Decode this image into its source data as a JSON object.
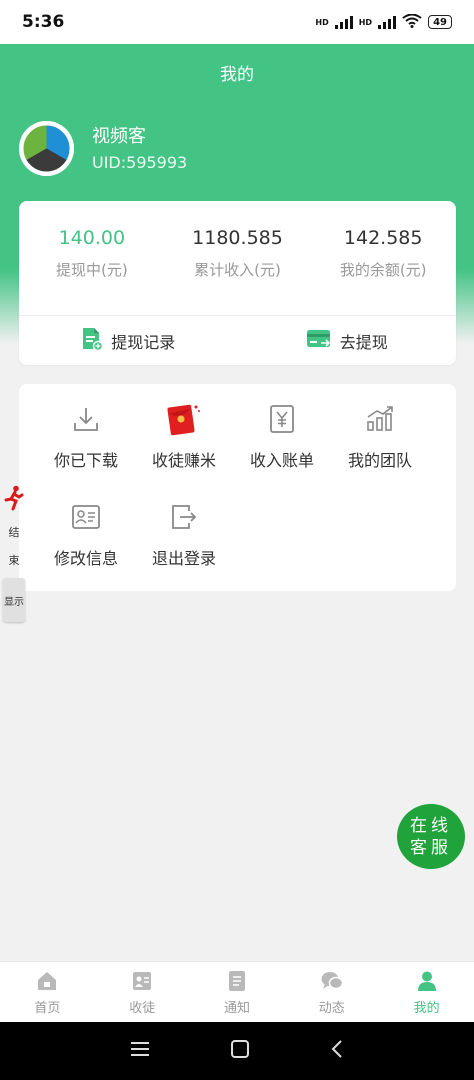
{
  "status": {
    "time": "5:36",
    "hd1": "HD",
    "hd2": "HD",
    "battery": "49"
  },
  "header": {
    "title": "我的"
  },
  "profile": {
    "name": "视频客",
    "uid": "UID:595993"
  },
  "stats": [
    {
      "value": "140.00",
      "label": "提现中(元)"
    },
    {
      "value": "1180.585",
      "label": "累计收入(元)"
    },
    {
      "value": "142.585",
      "label": "我的余额(元)"
    }
  ],
  "actions": {
    "records": "提现记录",
    "withdraw": "去提现"
  },
  "menu": [
    {
      "label": "你已下载",
      "icon": "download-icon"
    },
    {
      "label": "收徒赚米",
      "icon": "red-envelope-icon"
    },
    {
      "label": "收入账单",
      "icon": "bill-icon"
    },
    {
      "label": "我的团队",
      "icon": "team-chart-icon"
    },
    {
      "label": "修改信息",
      "icon": "id-card-icon"
    },
    {
      "label": "退出登录",
      "icon": "logout-icon"
    }
  ],
  "float_tool": {
    "label1": "结",
    "label2": "束",
    "show": "显示"
  },
  "customer_service": {
    "line1": "在线",
    "line2": "客服"
  },
  "tabs": [
    {
      "label": "首页",
      "icon": "home-icon"
    },
    {
      "label": "收徒",
      "icon": "recruit-icon"
    },
    {
      "label": "通知",
      "icon": "notice-icon"
    },
    {
      "label": "动态",
      "icon": "chat-icon"
    },
    {
      "label": "我的",
      "icon": "user-icon"
    }
  ],
  "colors": {
    "accent": "#43c384",
    "cs_button": "#1fa33a",
    "red": "#e02020"
  }
}
